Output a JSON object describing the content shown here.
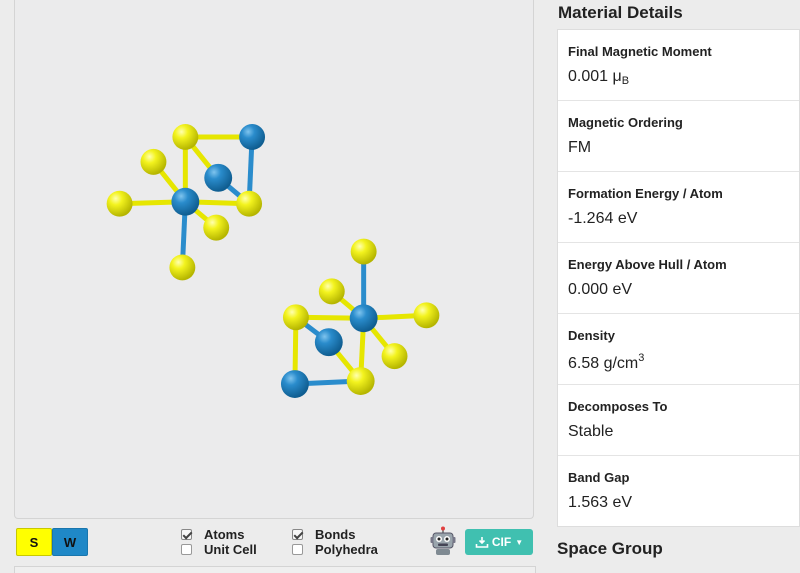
{
  "legend": [
    {
      "symbol": "S",
      "color": "#ffff00"
    },
    {
      "symbol": "W",
      "color": "#1f88c7"
    }
  ],
  "options": {
    "atoms": {
      "label": "Atoms",
      "checked": true
    },
    "unit_cell": {
      "label": "Unit Cell",
      "checked": false
    },
    "bonds": {
      "label": "Bonds",
      "checked": true
    },
    "polyhedra": {
      "label": "Polyhedra",
      "checked": false
    }
  },
  "robot_icon": "robot-icon",
  "download": {
    "label": "CIF",
    "icon": "download-icon"
  },
  "material_details": {
    "title": "Material Details",
    "final_magnetic_moment": {
      "label": "Final Magnetic Moment",
      "value": "0.001 μ",
      "unit_sub": "B"
    },
    "magnetic_ordering": {
      "label": "Magnetic Ordering",
      "value": "FM"
    },
    "formation_energy": {
      "label": "Formation Energy / Atom",
      "value": "-1.264 eV"
    },
    "energy_above_hull": {
      "label": "Energy Above Hull / Atom",
      "value": "0.000 eV"
    },
    "density": {
      "label": "Density",
      "value": "6.58 g/cm",
      "unit_sup": "3"
    },
    "decomposes_to": {
      "label": "Decomposes To",
      "value": "Stable"
    },
    "band_gap": {
      "label": "Band Gap",
      "value": "1.563 eV"
    }
  },
  "space_group_title": "Space Group"
}
